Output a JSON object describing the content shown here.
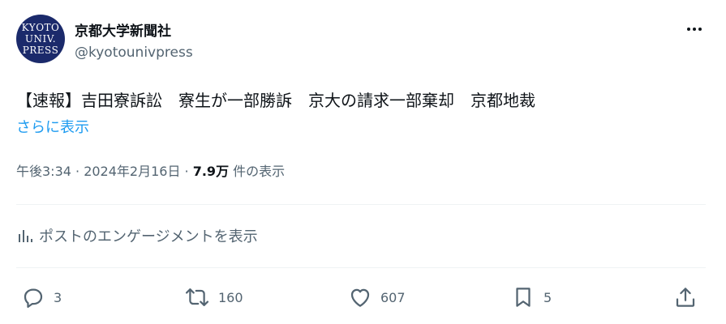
{
  "account": {
    "avatar_lines": [
      "KYOTO",
      "UNIV.",
      "PRESS"
    ],
    "name": "京都大学新聞社",
    "handle": "@kyotounivpress"
  },
  "tweet": {
    "text": "【速報】吉田寮訴訟　寮生が一部勝訴　京大の請求一部棄却　京都地裁",
    "show_more_label": "さらに表示",
    "timestamp": "午後3:34 · 2024年2月16日",
    "view_count": "7.9万",
    "views_label": "件の表示"
  },
  "engagement_link": "ポストのエンゲージメントを表示",
  "actions": {
    "replies": "3",
    "reposts": "160",
    "likes": "607",
    "bookmarks": "5"
  },
  "icons": {
    "more": "more-icon",
    "analytics": "analytics-icon",
    "reply": "reply-icon",
    "repost": "repost-icon",
    "like": "heart-icon",
    "bookmark": "bookmark-icon",
    "share": "share-icon"
  },
  "colors": {
    "link": "#1d9bf0",
    "secondary": "#536471",
    "primary": "#0f1419"
  }
}
